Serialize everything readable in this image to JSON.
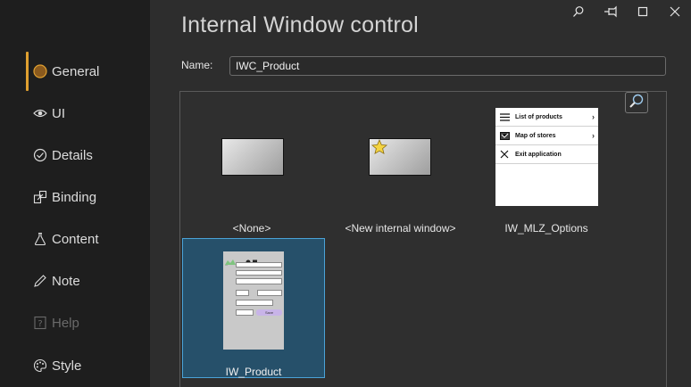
{
  "window": {
    "title": "Internal Window control",
    "buttons": [
      "search-icon",
      "pin-icon",
      "maximize-icon",
      "close-icon"
    ]
  },
  "sidebar": {
    "items": [
      {
        "label": "General",
        "icon": "circle-dot-icon",
        "active": true
      },
      {
        "label": "UI",
        "icon": "eye-icon"
      },
      {
        "label": "Details",
        "icon": "clock-icon"
      },
      {
        "label": "Binding",
        "icon": "binding-icon"
      },
      {
        "label": "Content",
        "icon": "flask-icon"
      },
      {
        "label": "Note",
        "icon": "pencil-icon"
      },
      {
        "label": "Help",
        "icon": "help-icon",
        "disabled": true
      },
      {
        "label": "Style",
        "icon": "palette-icon"
      }
    ]
  },
  "form": {
    "name_label": "Name:",
    "name_value": "IWC_Product"
  },
  "gallery": {
    "tiles": [
      {
        "caption": "<None>"
      },
      {
        "caption": "<New internal window>"
      },
      {
        "caption": "IW_MLZ_Options",
        "menu": [
          "List of products",
          "Map of stores",
          "Exit application"
        ]
      },
      {
        "caption": "IW_Product",
        "selected": true
      }
    ],
    "product_form": {
      "button": "Save"
    }
  },
  "colors": {
    "accent": "#e0a030",
    "selection": "#26506a",
    "selection_border": "#4aa3d8"
  }
}
